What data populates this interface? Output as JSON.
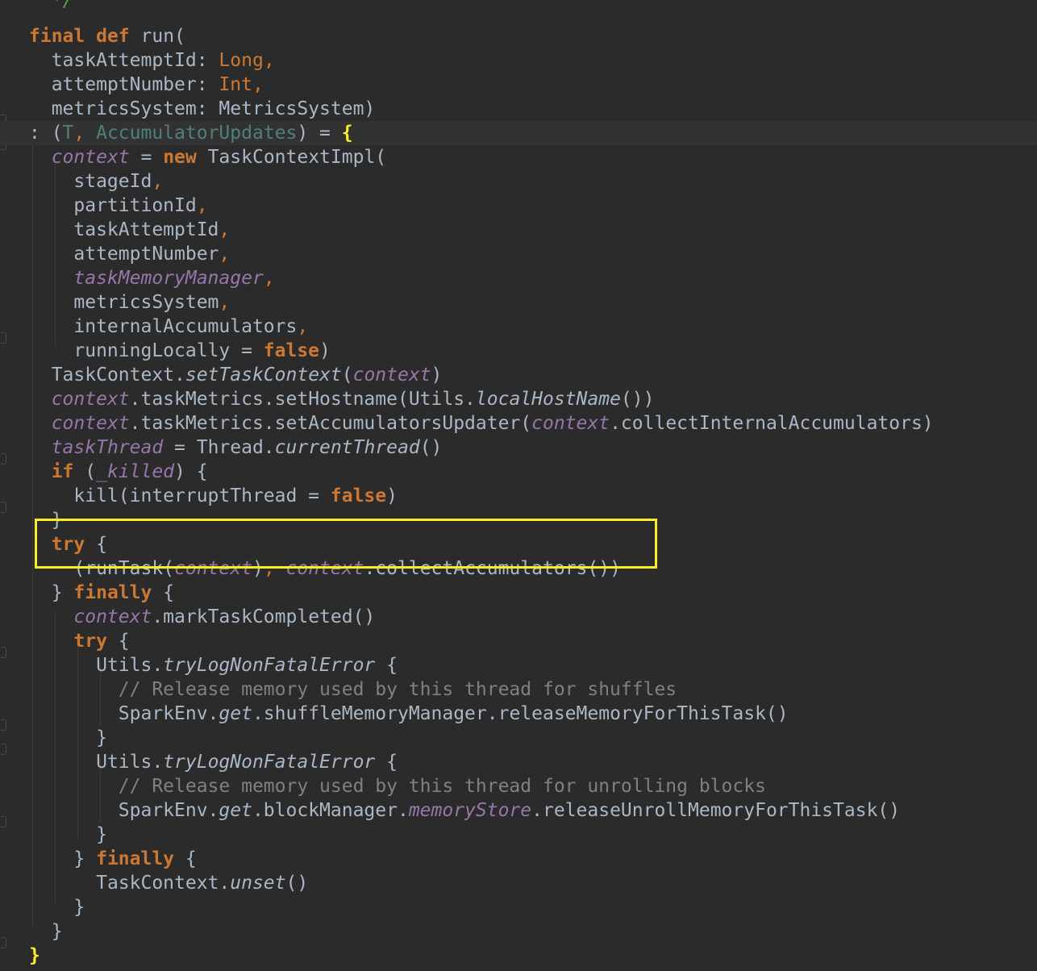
{
  "code_lines": [
    {
      "indent": "  ",
      "tokens": [
        {
          "t": "*/",
          "c": "doc"
        }
      ]
    },
    {
      "indent": "",
      "tokens": [
        {
          "t": "final",
          "c": "kw"
        },
        {
          "t": " "
        },
        {
          "t": "def",
          "c": "kw"
        },
        {
          "t": " run("
        }
      ]
    },
    {
      "indent": "  ",
      "tokens": [
        {
          "t": "taskAttemptId: "
        },
        {
          "t": "Long",
          "c": "ty"
        },
        {
          "t": ",",
          "c": "punc-o"
        }
      ]
    },
    {
      "indent": "  ",
      "tokens": [
        {
          "t": "attemptNumber: "
        },
        {
          "t": "Int",
          "c": "ty"
        },
        {
          "t": ",",
          "c": "punc-o"
        }
      ]
    },
    {
      "indent": "  ",
      "tokens": [
        {
          "t": "metricsSystem: MetricsSystem)"
        }
      ]
    },
    {
      "indent": "",
      "current": true,
      "tokens": [
        {
          "t": ": ("
        },
        {
          "t": "T",
          "c": "tp"
        },
        {
          "t": ", ",
          "c": "punc-o"
        },
        {
          "t": "AccumulatorUpdates",
          "c": "tp"
        },
        {
          "t": ") = "
        },
        {
          "t": "{",
          "c": "brace-hl"
        }
      ]
    },
    {
      "indent": "  ",
      "tokens": [
        {
          "t": "context",
          "c": "fld"
        },
        {
          "t": " = "
        },
        {
          "t": "new",
          "c": "kw"
        },
        {
          "t": " TaskContextImpl("
        }
      ]
    },
    {
      "indent": "    ",
      "tokens": [
        {
          "t": "stageId"
        },
        {
          "t": ",",
          "c": "punc-o"
        }
      ]
    },
    {
      "indent": "    ",
      "tokens": [
        {
          "t": "partitionId"
        },
        {
          "t": ",",
          "c": "punc-o"
        }
      ]
    },
    {
      "indent": "    ",
      "tokens": [
        {
          "t": "taskAttemptId"
        },
        {
          "t": ",",
          "c": "punc-o"
        }
      ]
    },
    {
      "indent": "    ",
      "tokens": [
        {
          "t": "attemptNumber"
        },
        {
          "t": ",",
          "c": "punc-o"
        }
      ]
    },
    {
      "indent": "    ",
      "tokens": [
        {
          "t": "taskMemoryManager",
          "c": "fld"
        },
        {
          "t": ",",
          "c": "punc-o"
        }
      ]
    },
    {
      "indent": "    ",
      "tokens": [
        {
          "t": "metricsSystem"
        },
        {
          "t": ",",
          "c": "punc-o"
        }
      ]
    },
    {
      "indent": "    ",
      "tokens": [
        {
          "t": "internalAccumulators"
        },
        {
          "t": ",",
          "c": "punc-o"
        }
      ]
    },
    {
      "indent": "    ",
      "tokens": [
        {
          "t": "runningLocally = "
        },
        {
          "t": "false",
          "c": "kw"
        },
        {
          "t": ")"
        }
      ]
    },
    {
      "indent": "  ",
      "tokens": [
        {
          "t": "TaskContext."
        },
        {
          "t": "setTaskContext",
          "c": "it"
        },
        {
          "t": "("
        },
        {
          "t": "context",
          "c": "fld"
        },
        {
          "t": ")"
        }
      ]
    },
    {
      "indent": "  ",
      "tokens": [
        {
          "t": "context",
          "c": "fld"
        },
        {
          "t": ".taskMetrics.setHostname(Utils."
        },
        {
          "t": "localHostName",
          "c": "it"
        },
        {
          "t": "())"
        }
      ]
    },
    {
      "indent": "  ",
      "tokens": [
        {
          "t": "context",
          "c": "fld"
        },
        {
          "t": ".taskMetrics.setAccumulatorsUpdater("
        },
        {
          "t": "context",
          "c": "fld"
        },
        {
          "t": ".collectInternalAccumulators)"
        }
      ]
    },
    {
      "indent": "  ",
      "tokens": [
        {
          "t": "taskThread",
          "c": "fld"
        },
        {
          "t": " = Thread."
        },
        {
          "t": "currentThread",
          "c": "it"
        },
        {
          "t": "()"
        }
      ]
    },
    {
      "indent": "  ",
      "tokens": [
        {
          "t": "if",
          "c": "kw"
        },
        {
          "t": " ("
        },
        {
          "t": "_killed",
          "c": "fld"
        },
        {
          "t": ") {"
        }
      ]
    },
    {
      "indent": "    ",
      "tokens": [
        {
          "t": "kill(interruptThread = "
        },
        {
          "t": "false",
          "c": "kw"
        },
        {
          "t": ")"
        }
      ]
    },
    {
      "indent": "  ",
      "tokens": [
        {
          "t": "}"
        }
      ]
    },
    {
      "indent": "  ",
      "tokens": [
        {
          "t": "try",
          "c": "kw"
        },
        {
          "t": " {"
        }
      ]
    },
    {
      "indent": "    ",
      "tokens": [
        {
          "t": "(runTask("
        },
        {
          "t": "context",
          "c": "fld"
        },
        {
          "t": ")"
        },
        {
          "t": ", ",
          "c": "punc-o"
        },
        {
          "t": "context",
          "c": "fld"
        },
        {
          "t": ".collectAccumulators())"
        }
      ]
    },
    {
      "indent": "  ",
      "tokens": [
        {
          "t": "} "
        },
        {
          "t": "finally",
          "c": "kw"
        },
        {
          "t": " {"
        }
      ]
    },
    {
      "indent": "    ",
      "tokens": [
        {
          "t": "context",
          "c": "fld"
        },
        {
          "t": ".markTaskCompleted()"
        }
      ]
    },
    {
      "indent": "    ",
      "tokens": [
        {
          "t": "try",
          "c": "kw"
        },
        {
          "t": " {"
        }
      ]
    },
    {
      "indent": "      ",
      "tokens": [
        {
          "t": "Utils."
        },
        {
          "t": "tryLogNonFatalError",
          "c": "it"
        },
        {
          "t": " {"
        }
      ]
    },
    {
      "indent": "        ",
      "tokens": [
        {
          "t": "// Release memory used by this thread for shuffles",
          "c": "cmt"
        }
      ]
    },
    {
      "indent": "        ",
      "tokens": [
        {
          "t": "SparkEnv."
        },
        {
          "t": "get",
          "c": "it"
        },
        {
          "t": ".shuffleMemoryManager.releaseMemoryForThisTask()"
        }
      ]
    },
    {
      "indent": "      ",
      "tokens": [
        {
          "t": "}"
        }
      ]
    },
    {
      "indent": "      ",
      "tokens": [
        {
          "t": "Utils."
        },
        {
          "t": "tryLogNonFatalError",
          "c": "it"
        },
        {
          "t": " {"
        }
      ]
    },
    {
      "indent": "        ",
      "tokens": [
        {
          "t": "// Release memory used by this thread for unrolling blocks",
          "c": "cmt"
        }
      ]
    },
    {
      "indent": "        ",
      "tokens": [
        {
          "t": "SparkEnv."
        },
        {
          "t": "get",
          "c": "it"
        },
        {
          "t": ".blockManager."
        },
        {
          "t": "memoryStore",
          "c": "fld"
        },
        {
          "t": ".releaseUnrollMemoryForThisTask()"
        }
      ]
    },
    {
      "indent": "      ",
      "tokens": [
        {
          "t": "}"
        }
      ]
    },
    {
      "indent": "    ",
      "tokens": [
        {
          "t": "} "
        },
        {
          "t": "finally",
          "c": "kw"
        },
        {
          "t": " {"
        }
      ]
    },
    {
      "indent": "      ",
      "tokens": [
        {
          "t": "TaskContext."
        },
        {
          "t": "unset",
          "c": "it"
        },
        {
          "t": "()"
        }
      ]
    },
    {
      "indent": "    ",
      "tokens": [
        {
          "t": "}"
        }
      ]
    },
    {
      "indent": "  ",
      "tokens": [
        {
          "t": "}"
        }
      ]
    },
    {
      "indent": "",
      "tokens": [
        {
          "t": "}",
          "c": "brace-hl"
        }
      ]
    }
  ],
  "colors": {
    "background": "#2b2b2b",
    "text": "#a9b7c6",
    "keyword": "#cc7832",
    "field": "#9876aa",
    "type_param": "#4e807d",
    "comment": "#808080",
    "highlight_box": "#f7f01e"
  }
}
